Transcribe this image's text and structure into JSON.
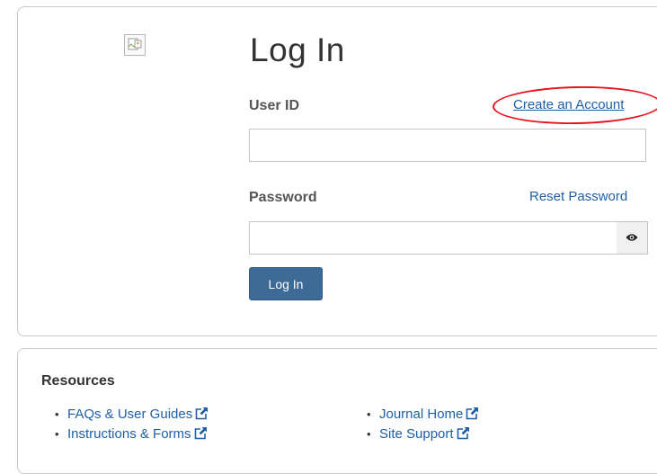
{
  "login": {
    "title": "Log In",
    "user_id_label": "User ID",
    "create_account_link": "Create an Account",
    "user_id_value": "",
    "password_label": "Password",
    "reset_password_link": "Reset Password",
    "password_value": "",
    "submit_label": "Log In"
  },
  "resources": {
    "heading": "Resources",
    "left_links": [
      {
        "label": "FAQs & User Guides",
        "icon": "external-link-icon"
      },
      {
        "label": "Instructions & Forms",
        "icon": "external-link-icon"
      }
    ],
    "right_links": [
      {
        "label": "Journal Home",
        "icon": "external-link-icon"
      },
      {
        "label": "Site Support",
        "icon": "external-link-icon"
      }
    ]
  },
  "icons": {
    "broken_image": "broken-image-icon",
    "show_password": "eye-icon"
  },
  "colors": {
    "link": "#1f5fa6",
    "primary_button": "#3e6a97",
    "highlight_ellipse": "#e8101c",
    "panel_border": "#c9c9c9"
  }
}
